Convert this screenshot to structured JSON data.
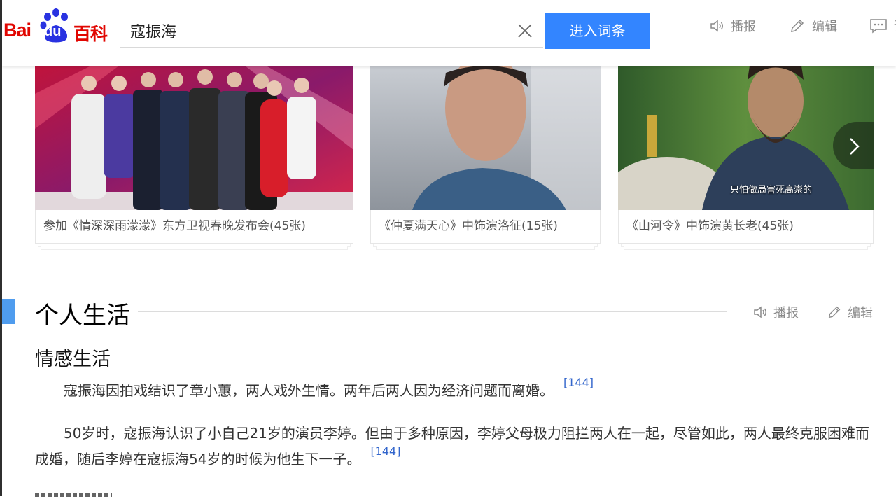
{
  "header": {
    "logo": {
      "bai": "Bai",
      "du": "du",
      "baike": "百科"
    },
    "search": {
      "value": "寇振海"
    },
    "enter_button": "进入词条",
    "actions": [
      {
        "label": "播报",
        "icon": "speaker-icon"
      },
      {
        "label": "编辑",
        "icon": "pencil-icon"
      },
      {
        "label": "讨",
        "icon": "comment-icon"
      }
    ]
  },
  "gallery": {
    "cards": [
      {
        "caption": "参加《情深深雨濛濛》东方卫视春晚发布会",
        "count": "(45张)"
      },
      {
        "caption": "《仲夏满天心》中饰演洛征",
        "count": "(15张)"
      },
      {
        "caption": "《山河令》中饰演黄长老",
        "count": "(45张)",
        "overlay": "只怕做局害死高崇的"
      }
    ]
  },
  "section": {
    "title": "个人生活",
    "actions": [
      {
        "label": "播报",
        "icon": "speaker-icon"
      },
      {
        "label": "编辑",
        "icon": "pencil-icon"
      }
    ],
    "subtitle": "情感生活",
    "paragraphs": [
      {
        "text": "寇振海因拍戏结识了章小蕙，两人戏外生情。两年后两人因为经济问题而离婚。",
        "ref": "[144]"
      },
      {
        "text": "50岁时，寇振海认识了小自己21岁的演员李婷。但由于多种原因，李婷父母极力阻拦两人在一起，尽管如此，两人最终克服困难而成婚，随后李婷在寇振海54岁的时候为他生下一子。",
        "ref": "[144]"
      }
    ]
  },
  "colors": {
    "brand_red": "#e10601",
    "brand_blue": "#3385ff",
    "section_marker": "#4f9cee",
    "link": "#3366cc"
  }
}
